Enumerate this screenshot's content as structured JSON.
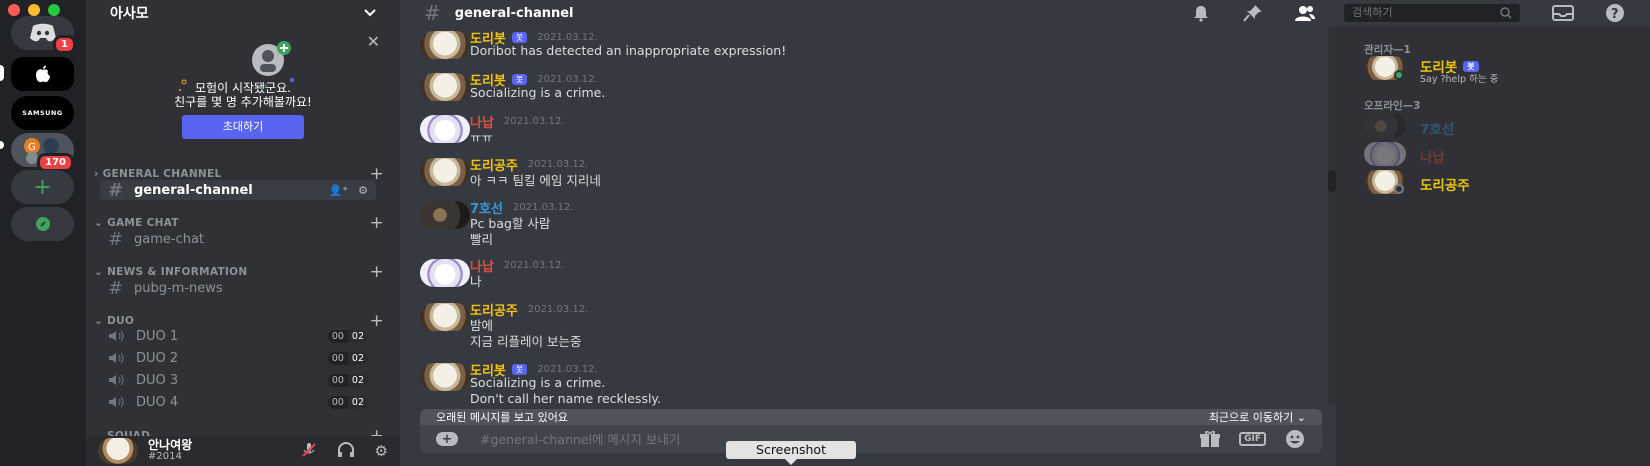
{
  "servers": {
    "home_badge": "1",
    "samsung_label": "SAMSUNG",
    "group_badge": "170"
  },
  "sidebar": {
    "server_name": "아사모",
    "invite_line1": "모험이 시작됐군요.",
    "invite_line2": "친구를 몇 명 추가해볼까요!",
    "invite_button": "초대하기",
    "categories": [
      {
        "label": "GENERAL CHANNEL",
        "channels": [
          "general-channel"
        ]
      },
      {
        "label": "GAME CHAT",
        "channels": [
          "game-chat"
        ]
      },
      {
        "label": "NEWS & INFORMATION",
        "channels": [
          "pubg-m-news"
        ]
      },
      {
        "label": "DUO",
        "channels": [
          "DUO 1",
          "DUO 2",
          "DUO 3",
          "DUO 4"
        ]
      },
      {
        "label": "SQUAD",
        "channels": []
      }
    ],
    "voice_count_a": "00",
    "voice_count_b": "02"
  },
  "user": {
    "name": "안나여왕",
    "tag": "#2014"
  },
  "header": {
    "channel_name": "general-channel",
    "search_placeholder": "검색하기"
  },
  "messages": [
    {
      "author": "도리봇",
      "bot": "봇",
      "time": "2021.03.12.",
      "lines": [
        "Doribot has detected an inappropriate expression!"
      ]
    },
    {
      "author": "도리봇",
      "bot": "봇",
      "time": "2021.03.12.",
      "lines": [
        "Socializing is a crime."
      ]
    },
    {
      "author": "나납",
      "time": "2021.03.12.",
      "lines": [
        "ㅠㅠ"
      ]
    },
    {
      "author": "도리공주",
      "time": "2021.03.12.",
      "lines": [
        "아 ㅋㅋ 팀킬 에임 지리네"
      ]
    },
    {
      "author": "7호선",
      "time": "2021.03.12.",
      "lines": [
        "Pc bag할 사람",
        "빨리"
      ]
    },
    {
      "author": "나납",
      "time": "2021.03.12.",
      "lines": [
        "나"
      ]
    },
    {
      "author": "도리공주",
      "time": "2021.03.12.",
      "lines": [
        "밤에",
        "지금 리플레이 보는중"
      ]
    },
    {
      "author": "도리봇",
      "bot": "봇",
      "time": "2021.03.12.",
      "lines": [
        "Socializing is a crime.",
        "Don't call her name recklessly."
      ]
    }
  ],
  "jump_bar": {
    "left": "오래된 메시지를 보고 있어요",
    "right": "최근으로 이동하기"
  },
  "composer": {
    "placeholder": "#general-channel에 메시지 보내기",
    "gif_label": "GIF"
  },
  "tooltip": "Screenshot",
  "members": {
    "admin_header": "관리자—1",
    "offline_header": "오프라인—3",
    "admin": [
      {
        "name": "도리봇",
        "bot": "봇",
        "status": "Say ?help 하는 중"
      }
    ],
    "offline": [
      {
        "name": "7호선"
      },
      {
        "name": "나납"
      },
      {
        "name": "도리공주"
      }
    ]
  },
  "colors": {
    "bot_name": "#f1c40f",
    "red_name": "#e74c3c",
    "blue_name": "#3498db",
    "accent": "#5865f2"
  }
}
